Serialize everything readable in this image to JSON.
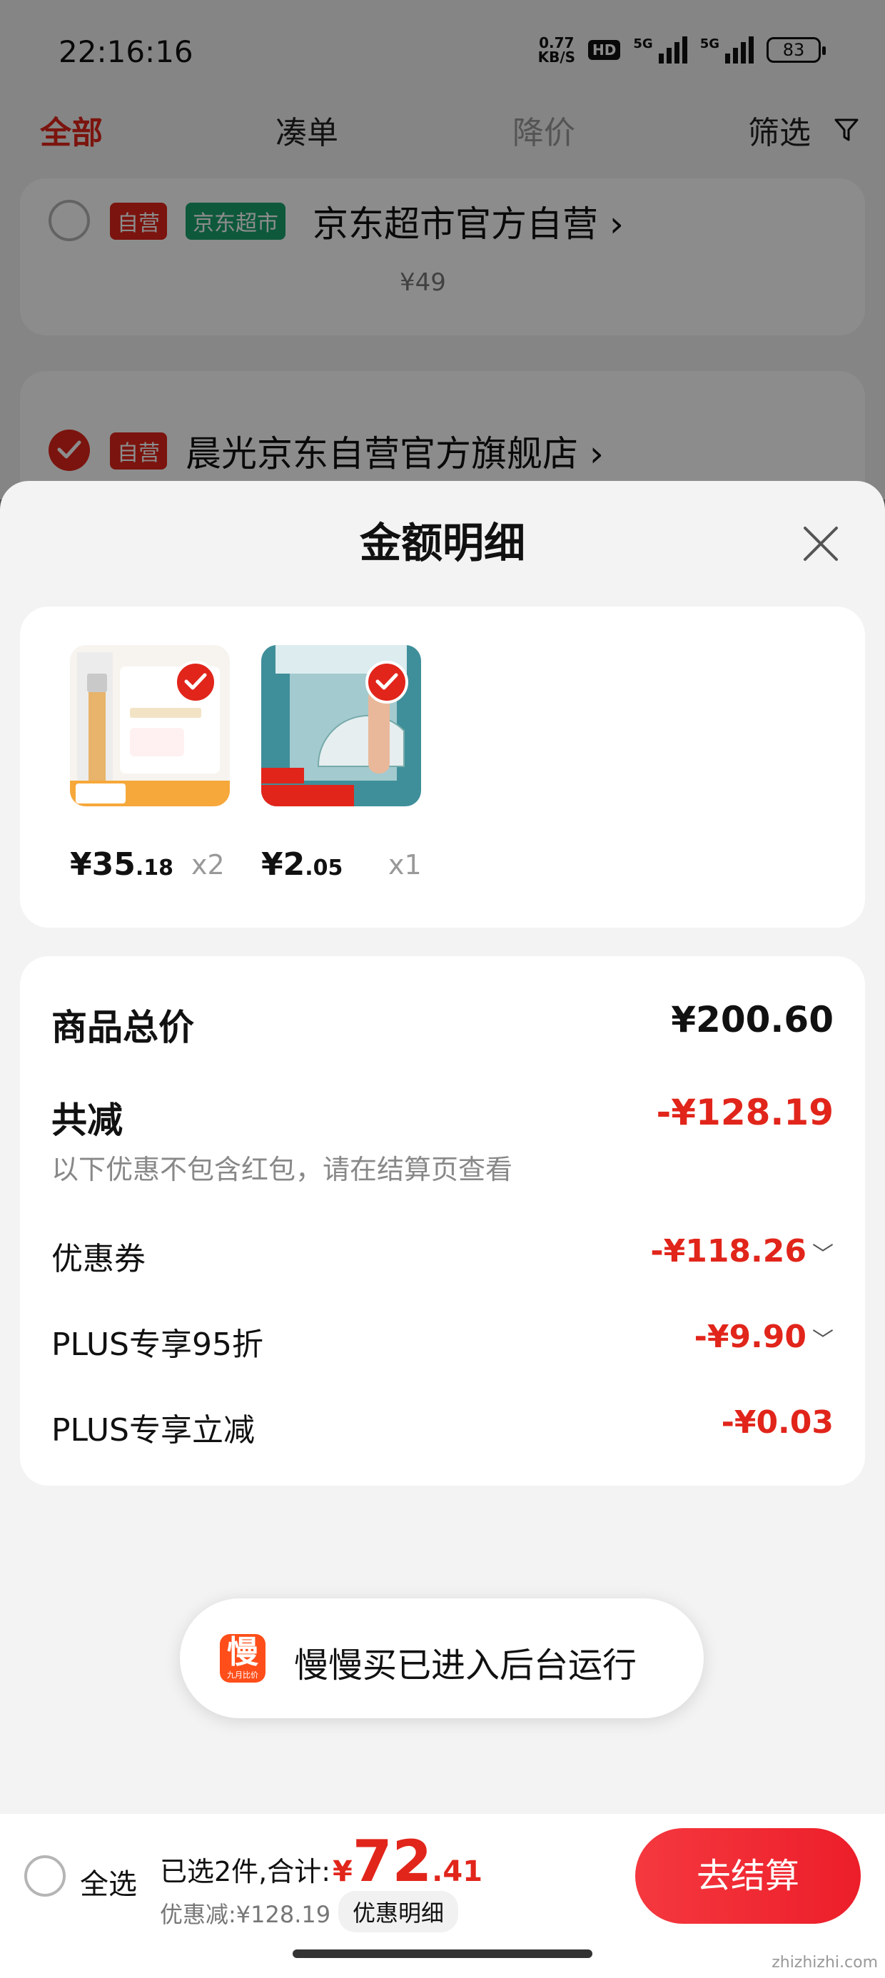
{
  "status_bar": {
    "time": "22:16:16",
    "net_speed_value": "0.77",
    "net_speed_unit": "KB/S",
    "hd_label": "HD",
    "signal_label_1": "5G",
    "signal_label_2": "5G",
    "battery": "83"
  },
  "tabs": {
    "all": "全部",
    "bundle": "凑单",
    "price_drop": "降价",
    "filter": "筛选"
  },
  "stores": [
    {
      "tag_self": "自营",
      "tag_market": "京东超市",
      "name": "京东超市官方自营",
      "price": "¥49",
      "checked": false
    },
    {
      "tag_self": "自营",
      "name": "晨光京东自营官方旗舰店",
      "checked": true
    }
  ],
  "sheet": {
    "title": "金额明细",
    "products": [
      {
        "price_int": "¥35",
        "price_dec": ".18",
        "qty": "x2"
      },
      {
        "price_int": "¥2",
        "price_dec": ".05",
        "qty": "x1"
      }
    ],
    "details": {
      "total_label": "商品总价",
      "total_value": "¥200.60",
      "reduce_label": "共减",
      "reduce_value": "-¥128.19",
      "note": "以下优惠不包含红包，请在结算页查看",
      "coupon_label": "优惠券",
      "coupon_value": "-¥118.26",
      "plus95_label": "PLUS专享95折",
      "plus95_value": "-¥9.90",
      "plus_cut_label": "PLUS专享立减",
      "plus_cut_value": "-¥0.03"
    }
  },
  "toast": {
    "logo_glyph": "慢",
    "logo_caption": "九月比价",
    "text": "慢慢买已进入后台运行"
  },
  "bottom_bar": {
    "select_all": "全选",
    "selected_summary": "已选2件,合计:",
    "currency": "¥",
    "total_int": "72",
    "total_dec": ".41",
    "discount_text": "优惠减:¥128.19",
    "detail_chip": "优惠明细",
    "checkout": "去结算"
  },
  "watermark": "zhizhizhi.com",
  "colors": {
    "accent_red": "#e1251b",
    "market_green": "#1aa36d"
  }
}
